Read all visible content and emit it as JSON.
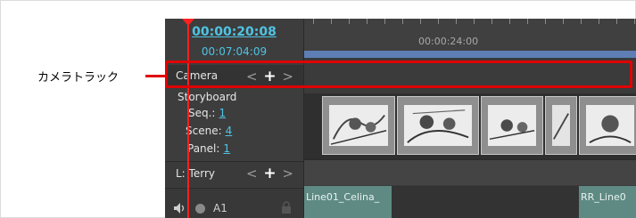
{
  "annotation": {
    "label": "カメラトラック"
  },
  "timecode": {
    "current": "00:00:20:08",
    "total": "00:07:04:09"
  },
  "ruler": {
    "label": "00:00:24:00"
  },
  "tracks": {
    "camera": {
      "name": "Camera",
      "prev": "<",
      "add": "+",
      "next": ">"
    },
    "storyboard": {
      "name": "Storyboard",
      "seq_label": "Seq.:",
      "seq_value": "1",
      "scene_label": "Scene:",
      "scene_value": "4",
      "panel_label": "Panel:",
      "panel_value": "1"
    },
    "layer": {
      "name": "L: Terry",
      "prev": "<",
      "add": "+",
      "next": ">"
    },
    "audio": {
      "name": "A1"
    }
  },
  "clips": [
    {
      "label": "Line01_Celina_"
    },
    {
      "label": "RR_Line0"
    }
  ],
  "colors": {
    "accent": "#4fc4e3",
    "highlight": "#e00000",
    "playhead": "#ff2020",
    "audio_clip": "#5f8a84"
  }
}
